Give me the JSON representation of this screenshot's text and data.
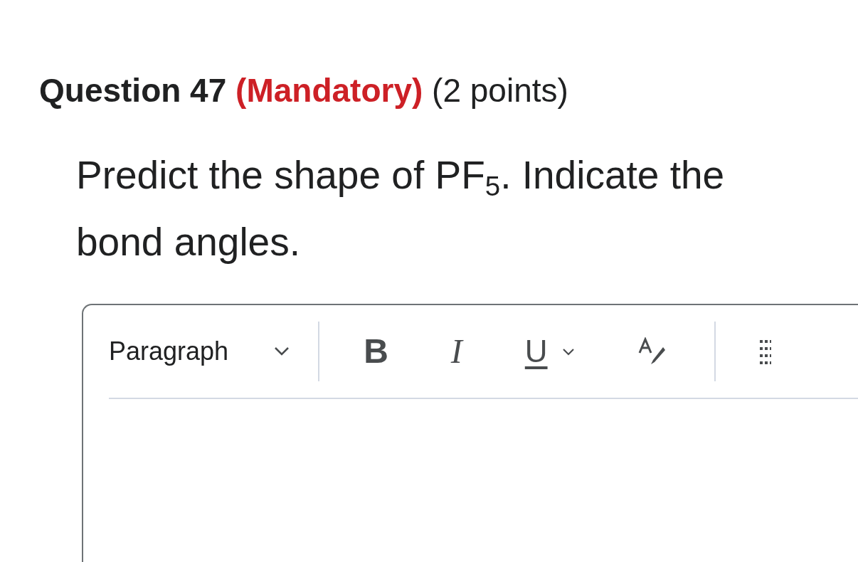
{
  "question": {
    "title": "Question 47",
    "mandatory": "(Mandatory)",
    "points": "(2 points)"
  },
  "prompt": "Predict the shape of PF$_{5}$. Indicate the bond angles.",
  "editor": {
    "format_select": "Paragraph",
    "toolbar": [
      {
        "kind": "bold",
        "label": "B",
        "dropdown": false
      },
      {
        "kind": "italic",
        "label": "I",
        "dropdown": false
      },
      {
        "kind": "underline",
        "label": "U",
        "dropdown": true
      }
    ]
  }
}
